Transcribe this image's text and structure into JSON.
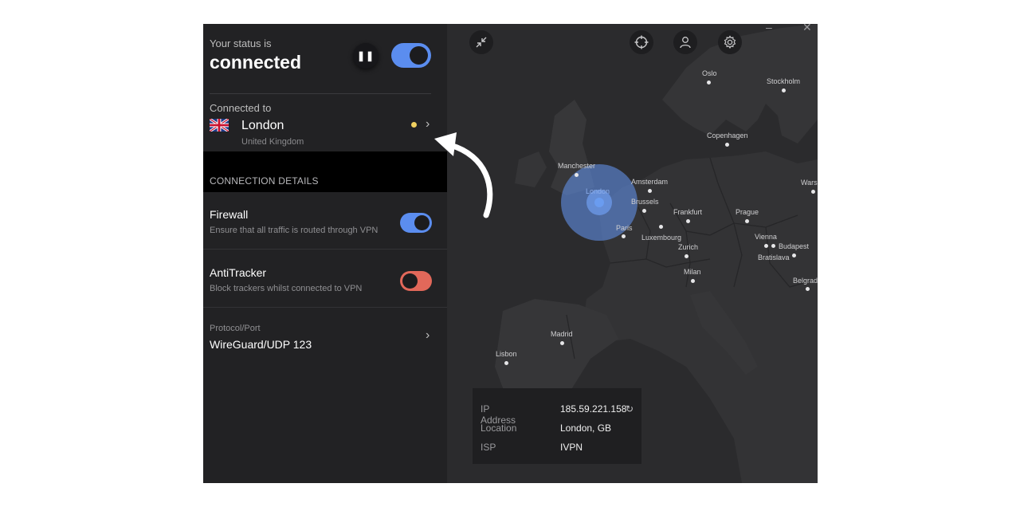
{
  "status": {
    "label": "Your status is",
    "value": "connected",
    "pause_glyph": "❚❚"
  },
  "connection": {
    "label": "Connected to",
    "city": "London",
    "country": "United Kingdom",
    "flag_icon": "uk-flag-icon",
    "ping_color": "#f0d060"
  },
  "details": {
    "heading": "CONNECTION DETAILS",
    "firewall": {
      "title": "Firewall",
      "description": "Ensure that all traffic is routed through VPN",
      "enabled": true
    },
    "antitracker": {
      "title": "AntiTracker",
      "description": "Block trackers whilst connected to VPN",
      "enabled": false
    },
    "protocol": {
      "label": "Protocol/Port",
      "value": "WireGuard/UDP 123"
    }
  },
  "map": {
    "cities": {
      "oslo": "Oslo",
      "stockholm": "Stockholm",
      "copenhagen": "Copenhagen",
      "manchester": "Manchester",
      "amsterdam": "Amsterdam",
      "london": "London",
      "brussels": "Brussels",
      "frankfurt": "Frankfurt",
      "prague": "Prague",
      "warsaw": "Wars",
      "paris": "Paris",
      "luxembourg": "Luxembourg",
      "vienna": "Vienna",
      "budapest": "Budapest",
      "zurich": "Zurich",
      "bratislava": "Bratislava",
      "milan": "Milan",
      "belgrade": "Belgrad",
      "madrid": "Madrid",
      "lisbon": "Lisbon"
    },
    "window_controls": {
      "minimize": "–",
      "close": "✕"
    }
  },
  "info": {
    "ip_label": "IP Address",
    "ip_value": "185.59.221.158",
    "location_label": "Location",
    "location_value": "London, GB",
    "isp_label": "ISP",
    "isp_value": "IVPN"
  },
  "colors": {
    "accent": "#5b8def",
    "antitracker_off": "#e2685a",
    "panel": "#222224",
    "map_bg": "#2b2b2d"
  }
}
